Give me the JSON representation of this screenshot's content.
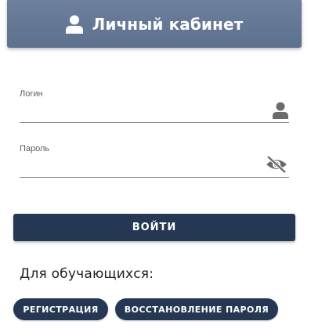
{
  "header": {
    "title": "Личный кабинет",
    "icon": "user-icon"
  },
  "form": {
    "login": {
      "label": "Логин",
      "value": "",
      "icon": "user-icon"
    },
    "password": {
      "label": "Пароль",
      "value": "",
      "icon": "eye-slash-icon"
    },
    "submit_label": "ВОЙТИ"
  },
  "students": {
    "title": "Для обучающихся:",
    "register_label": "РЕГИСТРАЦИЯ",
    "recover_label": "ВОССТАНОВЛЕНИЕ ПАРОЛЯ"
  },
  "colors": {
    "header_bg": "#637794",
    "button_bg": "#253853",
    "text": "#1f1f1f"
  }
}
